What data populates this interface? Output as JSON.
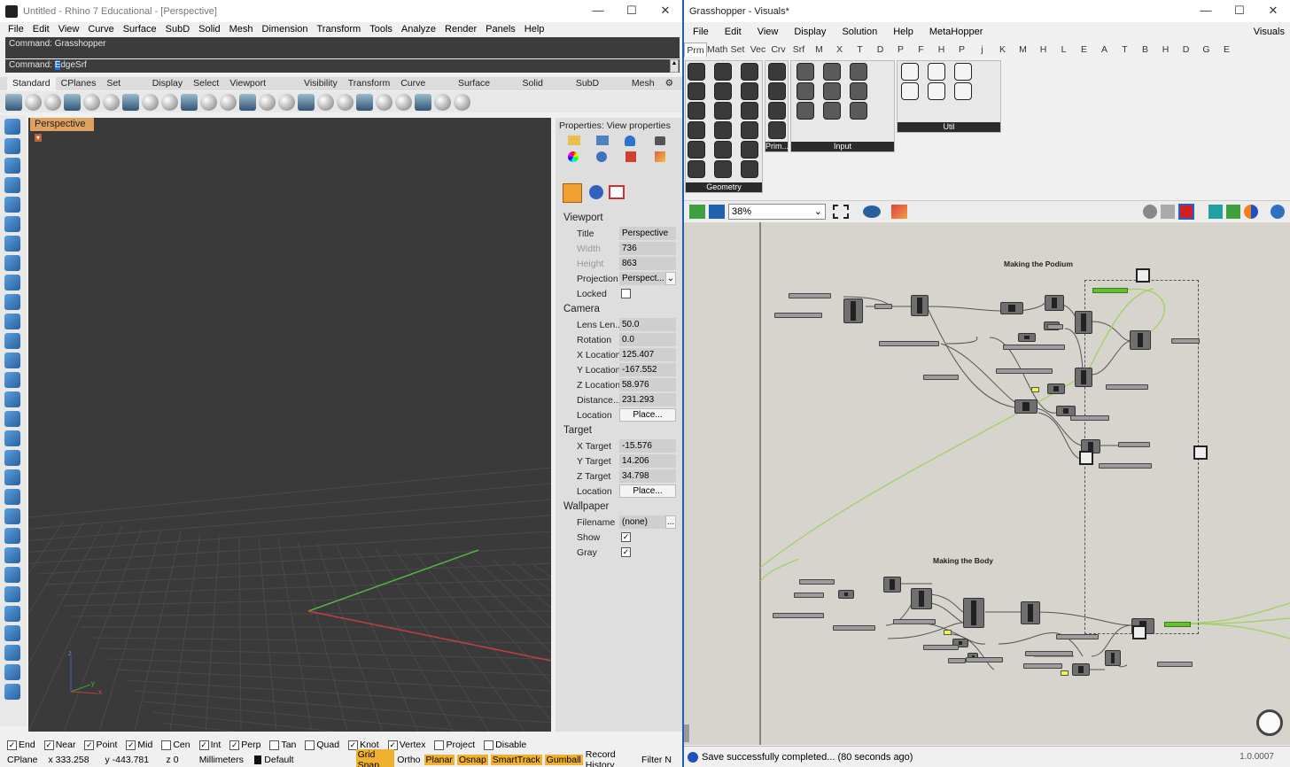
{
  "rhino": {
    "title": "Untitled - Rhino 7 Educational - [Perspective]",
    "menu": [
      "File",
      "Edit",
      "View",
      "Curve",
      "Surface",
      "SubD",
      "Solid",
      "Mesh",
      "Dimension",
      "Transform",
      "Tools",
      "Analyze",
      "Render",
      "Panels",
      "Help"
    ],
    "command_history": "Command: Grasshopper",
    "command_prompt": "Command:",
    "command_typed_sel": "E",
    "command_typed_rest": "dgeSrf",
    "toolbar_tabs": [
      "Standard",
      "CPlanes",
      "Set View",
      "Display",
      "Select",
      "Viewport Layout",
      "Visibility",
      "Transform",
      "Curve Tools",
      "Surface Tools",
      "Solid Tools",
      "SubD Tools",
      "Mesh"
    ],
    "viewport_tab": "Perspective",
    "properties": {
      "title": "Properties: View properties",
      "viewport_section": "Viewport",
      "viewport_rows": [
        {
          "label": "Title",
          "value": "Perspective",
          "dim": false
        },
        {
          "label": "Width",
          "value": "736",
          "dim": true
        },
        {
          "label": "Height",
          "value": "863",
          "dim": true
        },
        {
          "label": "Projection",
          "value": "Perspect...",
          "dim": false
        }
      ],
      "locked_label": "Locked",
      "camera_section": "Camera",
      "camera_rows": [
        {
          "label": "Lens Len...",
          "value": "50.0"
        },
        {
          "label": "Rotation",
          "value": "0.0"
        },
        {
          "label": "X Location",
          "value": "125.407"
        },
        {
          "label": "Y Location",
          "value": "-167.552"
        },
        {
          "label": "Z Location",
          "value": "58.976"
        },
        {
          "label": "Distance...",
          "value": "231.293"
        }
      ],
      "location_label": "Location",
      "place_button": "Place...",
      "target_section": "Target",
      "target_rows": [
        {
          "label": "X Target",
          "value": "-15.576"
        },
        {
          "label": "Y Target",
          "value": "14.206"
        },
        {
          "label": "Z Target",
          "value": "34.798"
        }
      ],
      "wallpaper_section": "Wallpaper",
      "filename_label": "Filename",
      "filename_value": "(none)",
      "show_label": "Show",
      "gray_label": "Gray"
    },
    "osnaps": [
      {
        "label": "End",
        "checked": true
      },
      {
        "label": "Near",
        "checked": true
      },
      {
        "label": "Point",
        "checked": true
      },
      {
        "label": "Mid",
        "checked": true
      },
      {
        "label": "Cen",
        "checked": false
      },
      {
        "label": "Int",
        "checked": true
      },
      {
        "label": "Perp",
        "checked": true
      },
      {
        "label": "Tan",
        "checked": false
      },
      {
        "label": "Quad",
        "checked": false
      },
      {
        "label": "Knot",
        "checked": true
      },
      {
        "label": "Vertex",
        "checked": true
      },
      {
        "label": "Project",
        "checked": false
      },
      {
        "label": "Disable",
        "checked": false
      }
    ],
    "status": {
      "cplane": "CPlane",
      "x": "x 333.258",
      "y": "y -443.781",
      "z": "z 0",
      "units": "Millimeters",
      "layer": "Default",
      "grid_snap": "Grid Snap",
      "ortho": "Ortho",
      "planar": "Planar",
      "osnap": "Osnap",
      "smarttrack": "SmartTrack",
      "gumball": "Gumball",
      "record_history": "Record History",
      "filter": "Filter",
      "filter_extra": "N"
    }
  },
  "grasshopper": {
    "title": "Grasshopper - Visuals*",
    "menu": [
      "File",
      "Edit",
      "View",
      "Display",
      "Solution",
      "Help",
      "MetaHopper"
    ],
    "menu_right": "Visuals",
    "tabs": [
      "Prm",
      "Math",
      "Set",
      "Vec",
      "Crv",
      "Srf",
      "M",
      "X",
      "T",
      "D",
      "P",
      "F",
      "H",
      "P",
      "j",
      "K",
      "M",
      "H",
      "L",
      "E",
      "A",
      "T",
      "B",
      "H",
      "D",
      "G",
      "E"
    ],
    "ribbon_groups": [
      "Geometry",
      "Prim...",
      "Input",
      "Util"
    ],
    "zoom": "38%",
    "groups": [
      "Making the Podium",
      "Making the Body"
    ],
    "status_msg": "Save successfully completed... (80 seconds ago)",
    "version": "1.0.0007"
  },
  "colors": {
    "accent": "#f0b030",
    "viewport_bg": "#3a3a3a",
    "canvas_bg": "#d6d4cc",
    "wire_green": "#8fd050"
  }
}
